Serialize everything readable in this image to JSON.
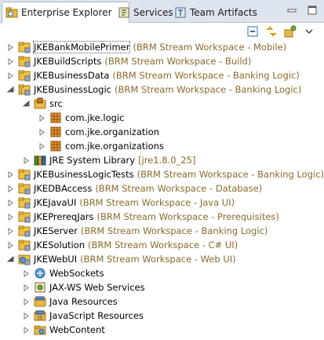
{
  "tabs": [
    {
      "label": "Enterprise Explorer",
      "icon": "enterprise-explorer-icon",
      "active": true,
      "close": "✕"
    },
    {
      "label": "Services",
      "icon": "services-icon",
      "active": false
    },
    {
      "label": "Team Artifacts",
      "icon": "team-artifacts-icon",
      "active": false
    }
  ],
  "toolbar": [
    "collapse-all-icon",
    "link-with-editor-icon",
    "view-menu-tools-icon",
    "view-menu-chevron-icon"
  ],
  "tree": [
    {
      "label": "JKEBankMobilePrimer",
      "decoration": "(BRM Stream Workspace - Mobile)",
      "level": 0,
      "expanded": false,
      "icon": "project-icon",
      "selected": true
    },
    {
      "label": "JKEBuildScripts",
      "decoration": "(BRM Stream Workspace - Build)",
      "level": 0,
      "expanded": false,
      "icon": "project-icon"
    },
    {
      "label": "JKEBusinessData",
      "decoration": "(BRM Stream Workspace - Banking Logic)",
      "level": 0,
      "expanded": false,
      "icon": "project-icon"
    },
    {
      "label": "JKEBusinessLogic",
      "decoration": "(BRM Stream Workspace - Banking Logic)",
      "level": 0,
      "expanded": true,
      "icon": "java-project-icon"
    },
    {
      "label": "src",
      "decoration": "",
      "level": 1,
      "expanded": true,
      "icon": "source-folder-icon"
    },
    {
      "label": "com.jke.logic",
      "decoration": "",
      "level": 2,
      "expanded": false,
      "icon": "package-icon"
    },
    {
      "label": "com.jke.organization",
      "decoration": "",
      "level": 2,
      "expanded": false,
      "icon": "package-icon"
    },
    {
      "label": "com.jke.organizations",
      "decoration": "",
      "level": 2,
      "expanded": false,
      "icon": "package-icon"
    },
    {
      "label": "JRE System Library",
      "decoration": "[jre1.8.0_25]",
      "level": 1,
      "expanded": false,
      "icon": "library-icon"
    },
    {
      "label": "JKEBusinessLogicTests",
      "decoration": "(BRM Stream Workspace - Banking Logic)",
      "level": 0,
      "expanded": false,
      "icon": "project-icon"
    },
    {
      "label": "JKEDBAccess",
      "decoration": "(BRM Stream Workspace - Database)",
      "level": 0,
      "expanded": false,
      "icon": "project-icon"
    },
    {
      "label": "JKEJavaUI",
      "decoration": "(BRM Stream Workspace - Java UI)",
      "level": 0,
      "expanded": false,
      "icon": "project-icon"
    },
    {
      "label": "JKEPrereqJars",
      "decoration": "(BRM Stream Workspace - Prerequisites)",
      "level": 0,
      "expanded": false,
      "icon": "project-icon"
    },
    {
      "label": "JKEServer",
      "decoration": "(BRM Stream Workspace - Banking Logic)",
      "level": 0,
      "expanded": false,
      "icon": "project-icon"
    },
    {
      "label": "JKESolution",
      "decoration": "(BRM Stream Workspace - C# UI)",
      "level": 0,
      "expanded": false,
      "icon": "project-icon"
    },
    {
      "label": "JKEWebUI",
      "decoration": "(BRM Stream Workspace - Web UI)",
      "level": 0,
      "expanded": true,
      "icon": "web-project-icon"
    },
    {
      "label": "WebSockets",
      "decoration": "",
      "level": 1,
      "expanded": false,
      "icon": "websockets-icon"
    },
    {
      "label": "JAX-WS Web Services",
      "decoration": "",
      "level": 1,
      "expanded": false,
      "icon": "webservices-icon"
    },
    {
      "label": "Java Resources",
      "decoration": "",
      "level": 1,
      "expanded": false,
      "icon": "java-resources-icon"
    },
    {
      "label": "JavaScript Resources",
      "decoration": "",
      "level": 1,
      "expanded": false,
      "icon": "javascript-resources-icon"
    },
    {
      "label": "WebContent",
      "decoration": "",
      "level": 1,
      "expanded": false,
      "icon": "webcontent-folder-icon"
    }
  ],
  "colors": {
    "tab_bar": "#dde4ee",
    "decoration": "#8a6a2b",
    "folder": "#e8b847",
    "project": "#f0c040"
  }
}
